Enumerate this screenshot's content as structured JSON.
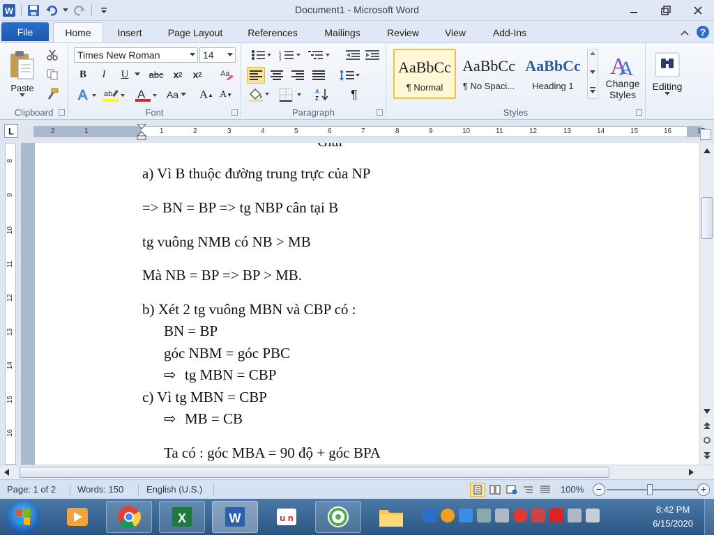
{
  "window": {
    "title": "Document1 - Microsoft Word"
  },
  "tabs": {
    "file": "File",
    "items": [
      "Home",
      "Insert",
      "Page Layout",
      "References",
      "Mailings",
      "Review",
      "View",
      "Add-Ins"
    ],
    "active": "Home"
  },
  "ribbon": {
    "clipboard": {
      "label": "Clipboard",
      "paste": "Paste"
    },
    "font": {
      "label": "Font",
      "family": "Times New Roman",
      "size": "14"
    },
    "paragraph": {
      "label": "Paragraph"
    },
    "styles": {
      "label": "Styles",
      "items": [
        {
          "sample": "AaBbCc",
          "name": "¶ Normal"
        },
        {
          "sample": "AaBbCc",
          "name": "¶ No Spaci..."
        },
        {
          "sample": "AaBbCc",
          "name": "Heading 1"
        }
      ],
      "change_line1": "Change",
      "change_line2": "Styles"
    },
    "editing": {
      "label": "Editing"
    }
  },
  "ruler": {
    "h_labels": [
      "2",
      "1",
      "1",
      "2",
      "3",
      "4",
      "5",
      "6",
      "7",
      "8",
      "9",
      "10",
      "11",
      "12",
      "13",
      "14",
      "15",
      "16",
      "17"
    ],
    "v_labels": [
      "8",
      "9",
      "10",
      "11",
      "12",
      "13",
      "14",
      "15",
      "16"
    ]
  },
  "document": {
    "top_partial": "Giải",
    "lines": [
      "a)  Vì B thuộc đường trung trực  của NP",
      "=> BN = BP => tg NBP cân tại B",
      "tg vuông NMB có NB > MB",
      "Mà NB = BP => BP > MB.",
      "b)  Xét 2 tg vuông MBN và CBP có :",
      "BN = BP",
      "góc NBM = góc PBC",
      "tg MBN = CBP",
      "c)  Vì tg MBN = CBP",
      "MB = CB",
      "Ta có : góc MBA = 90 độ + góc BPA"
    ],
    "arrow": "⇨"
  },
  "status": {
    "page": "Page: 1 of 2",
    "words": "Words: 150",
    "language": "English (U.S.)",
    "zoom": "100%"
  },
  "taskbar": {
    "time": "8:42 PM",
    "date": "6/15/2020"
  },
  "colors": {
    "file_tab": "#2b6fc9",
    "style_selected": "#f2c040",
    "heading_blue": "#2a5b9c"
  }
}
